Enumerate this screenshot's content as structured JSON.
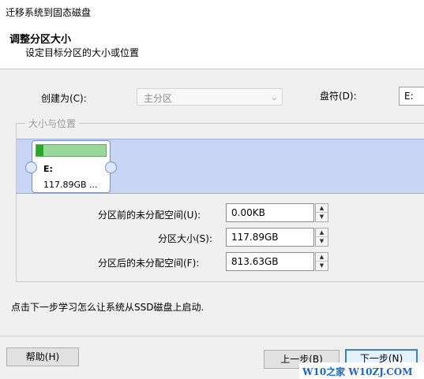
{
  "window": {
    "title": "迁移系统到固态磁盘"
  },
  "header": {
    "title": "调整分区大小",
    "subtitle": "设定目标分区的大小或位置"
  },
  "create_as": {
    "label": "创建为(C):",
    "value": "主分区"
  },
  "drive_letter": {
    "label": "盘符(D):",
    "value": "E:"
  },
  "size_position": {
    "group_title": "大小与位置",
    "partition": {
      "letter": "E:",
      "size_text": "117.89GB ...",
      "used_fraction": 0.1,
      "fill_fraction": 0.7
    },
    "unalloc_before": {
      "label": "分区前的未分配空间(U):",
      "value": "0.00KB"
    },
    "partition_size": {
      "label": "分区大小(S):",
      "value": "117.89GB"
    },
    "unalloc_after": {
      "label": "分区后的未分配空间(F):",
      "value": "813.63GB"
    }
  },
  "info_text": "点击下一步学习怎么让系统从SSD磁盘上启动.",
  "buttons": {
    "help": "帮助(H)",
    "back": "上一步(B)",
    "next": "下一步(N)"
  },
  "watermark": "W10之家 W10ZJ.COM",
  "colors": {
    "partition_bar": "#c9d5f4",
    "usage_green": "#27a827",
    "primary_border": "#3b7fd4"
  }
}
